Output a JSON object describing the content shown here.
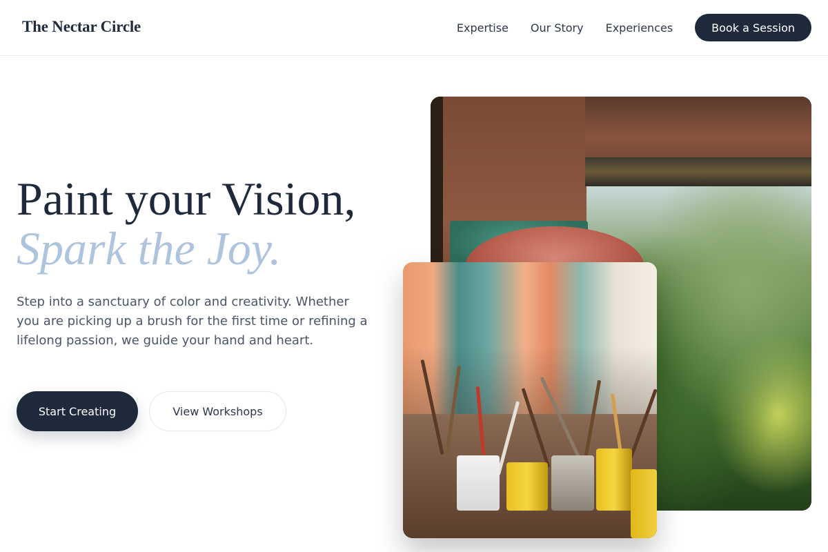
{
  "header": {
    "logo": "The Nectar Circle",
    "nav": [
      "Expertise",
      "Our Story",
      "Experiences"
    ],
    "cta": "Book a Session"
  },
  "hero": {
    "title_line1": "Paint your Vision,",
    "title_line2": "Spark the Joy.",
    "description": "Step into a sanctuary of color and creativity. Whether you are picking up a brush for the first time or refining a lifelong passion, we guide your hand and heart.",
    "primary_button": "Start Creating",
    "secondary_button": "View Workshops"
  },
  "images": {
    "back": "rusted-frame-garden-photo",
    "front": "paint-brushes-cans-photo"
  },
  "colors": {
    "primary": "#1e293b",
    "accent_title": "#aec3dc",
    "body_text": "#4a5568"
  }
}
